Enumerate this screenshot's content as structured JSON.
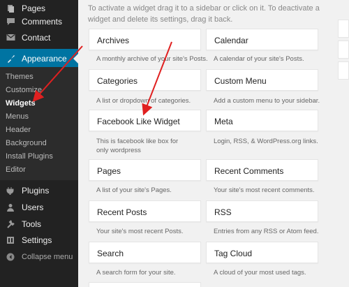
{
  "sidebar": {
    "items": [
      {
        "label": "Pages",
        "icon": "pages-icon"
      },
      {
        "label": "Comments",
        "icon": "comments-icon"
      },
      {
        "label": "Contact",
        "icon": "contact-icon"
      },
      {
        "label": "Appearance",
        "icon": "appearance-icon"
      },
      {
        "label": "Plugins",
        "icon": "plugins-icon"
      },
      {
        "label": "Users",
        "icon": "users-icon"
      },
      {
        "label": "Tools",
        "icon": "tools-icon"
      },
      {
        "label": "Settings",
        "icon": "settings-icon"
      },
      {
        "label": "Collapse menu",
        "icon": "collapse-icon"
      }
    ],
    "submenu": [
      "Themes",
      "Customize",
      "Widgets",
      "Menus",
      "Header",
      "Background",
      "Install Plugins",
      "Editor"
    ],
    "active_color": "#0074a2"
  },
  "main": {
    "intro": "To activate a widget drag it to a sidebar or click on it. To deactivate a widget and delete its settings, drag it back.",
    "widgets": [
      {
        "title": "Archives",
        "description": "A monthly archive of your site's Posts."
      },
      {
        "title": "Calendar",
        "description": "A calendar of your site's Posts."
      },
      {
        "title": "Categories",
        "description": "A list or dropdown of categories."
      },
      {
        "title": "Custom Menu",
        "description": "Add a custom menu to your sidebar."
      },
      {
        "title": "Facebook Like Widget",
        "description": "This is facebook like box for only wordpress"
      },
      {
        "title": "Meta",
        "description": "Login, RSS, & WordPress.org links."
      },
      {
        "title": "Pages",
        "description": "A list of your site's Pages."
      },
      {
        "title": "Recent Comments",
        "description": "Your site's most recent comments."
      },
      {
        "title": "Recent Posts",
        "description": "Your site's most recent Posts."
      },
      {
        "title": "RSS",
        "description": "Entries from any RSS or Atom feed."
      },
      {
        "title": "Search",
        "description": "A search form for your site."
      },
      {
        "title": "Tag Cloud",
        "description": "A cloud of your most used tags."
      }
    ]
  },
  "annotation_color": "#e02020"
}
